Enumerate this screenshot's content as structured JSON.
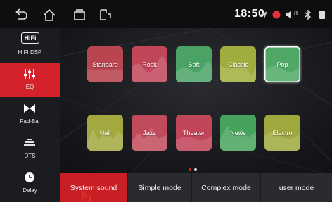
{
  "topbar": {
    "icons": [
      "back-icon",
      "home-icon",
      "recent-apps-icon",
      "screen-cast-icon"
    ],
    "time": "18:50",
    "status_icons": [
      "gps-icon",
      "record-icon",
      "volume-icon",
      "bluetooth-icon",
      "battery-icon"
    ],
    "volume_level": "8"
  },
  "sidebar": {
    "items": [
      {
        "label": "HIFI DSP",
        "icon": "hifi-icon",
        "active": false
      },
      {
        "label": "EQ",
        "icon": "equalizer-icon",
        "active": true
      },
      {
        "label": "Fad-Bal",
        "icon": "fader-balance-icon",
        "active": false
      },
      {
        "label": "DTS",
        "icon": "dts-icon",
        "active": false
      },
      {
        "label": "Delay",
        "icon": "clock-icon",
        "active": false
      }
    ],
    "hifi_badge": "HiFi"
  },
  "presets": [
    {
      "label": "Standard",
      "color": "#b8454f",
      "selected": false
    },
    {
      "label": "Rock",
      "color": "#c1465a",
      "selected": false
    },
    {
      "label": "Soft",
      "color": "#4aa365",
      "selected": false
    },
    {
      "label": "Classic",
      "color": "#a0ad3e",
      "selected": false
    },
    {
      "label": "Pop",
      "color": "#4fa865",
      "selected": true
    },
    {
      "label": "Hall",
      "color": "#a3a83f",
      "selected": false
    },
    {
      "label": "Jazz",
      "color": "#c14a5c",
      "selected": false
    },
    {
      "label": "Theater",
      "color": "#c2465a",
      "selected": false
    },
    {
      "label": "News",
      "color": "#46a35c",
      "selected": false
    },
    {
      "label": "Electro",
      "color": "#9fa83d",
      "selected": false
    }
  ],
  "page_dots": {
    "count": 2,
    "active_index": 0
  },
  "tabs": [
    {
      "label": "System sound",
      "active": true
    },
    {
      "label": "Simple mode",
      "active": false
    },
    {
      "label": "Complex mode",
      "active": false
    },
    {
      "label": "user mode",
      "active": false
    }
  ],
  "colors": {
    "accent": "#d3222a",
    "sidebar": "#1b1c1f",
    "topbar": "#0d0e10",
    "tab": "#2a2b2f"
  }
}
